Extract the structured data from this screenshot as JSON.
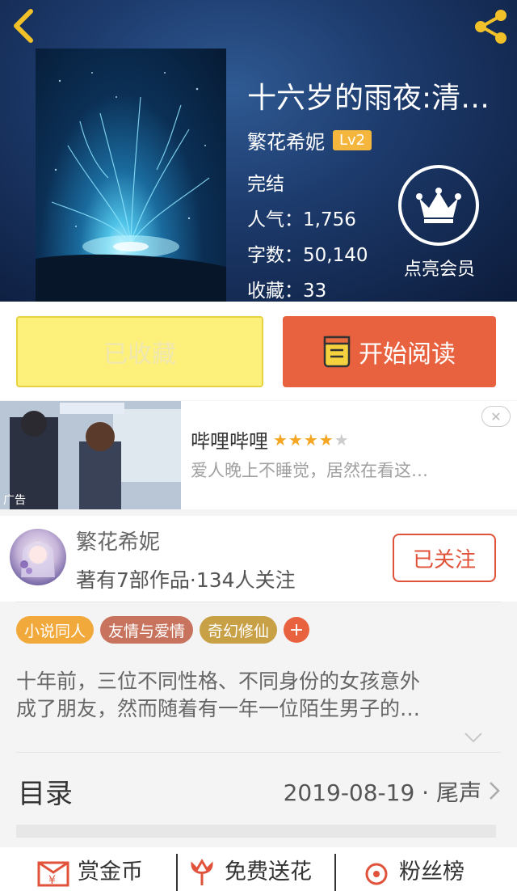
{
  "book": {
    "title": "十六岁的雨夜:清…",
    "author": "繁花希妮",
    "level": "Lv2",
    "status": "完结",
    "popularity_label": "人气：",
    "popularity": "1,756",
    "words_label": "字数：",
    "words": "50,140",
    "favorites_label": "收藏：",
    "favorites": "33"
  },
  "vip": {
    "label": "点亮会员"
  },
  "actions": {
    "collected_label": "已收藏",
    "read_label": "开始阅读"
  },
  "ad": {
    "title": "哔哩哔哩",
    "rating": 4,
    "rating_max": 5,
    "description": "爱人晚上不睡觉，居然在看这…",
    "tag": "广告"
  },
  "author_card": {
    "name": "繁花希妮",
    "meta": "著有7部作品·134人关注",
    "follow_label": "已关注"
  },
  "tags": [
    {
      "label": "小说同人",
      "color": "#f2a93b"
    },
    {
      "label": "友情与爱情",
      "color": "#c7735d"
    },
    {
      "label": "奇幻修仙",
      "color": "#c8a046"
    }
  ],
  "tag_more": "+",
  "synopsis": {
    "line1": "十年前，三位不同性格、不同身份的女孩意外",
    "line2": "成了朋友，然而随着有一年一位陌生男子的…"
  },
  "toc": {
    "label": "目录",
    "info": "2019-08-19 · 尾声"
  },
  "bottom": {
    "reward": "赏金币",
    "flower": "免费送花",
    "fans": "粉丝榜"
  },
  "colors": {
    "accent": "#e8623f",
    "collected_bg": "#fdf17b",
    "star": "#f5a623"
  }
}
